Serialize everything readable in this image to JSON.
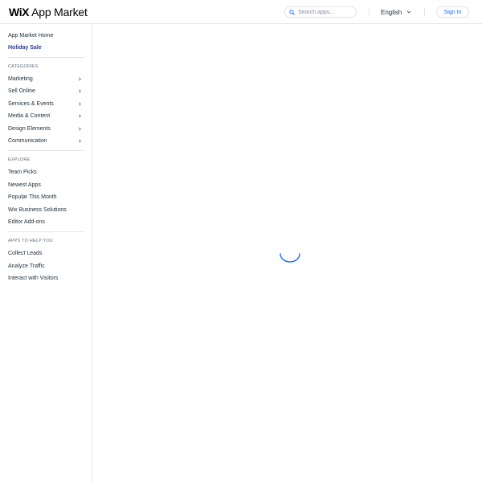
{
  "header": {
    "logo": {
      "brand": "WiX",
      "product": "App Market"
    },
    "search": {
      "placeholder": "Search apps..."
    },
    "language": "English",
    "sign_in": "Sign In"
  },
  "sidebar": {
    "top": [
      {
        "label": "App Market Home",
        "active": false
      },
      {
        "label": "Holiday Sale",
        "active": true
      }
    ],
    "categories": {
      "title": "CATEGORIES",
      "items": [
        {
          "label": "Marketing"
        },
        {
          "label": "Sell Online"
        },
        {
          "label": "Services & Events"
        },
        {
          "label": "Media & Content"
        },
        {
          "label": "Design Elements"
        },
        {
          "label": "Communication"
        }
      ]
    },
    "explore": {
      "title": "EXPLORE",
      "items": [
        {
          "label": "Team Picks"
        },
        {
          "label": "Newest Apps"
        },
        {
          "label": "Popular This Month"
        },
        {
          "label": "Wix Business Solutions"
        },
        {
          "label": "Editor Add-ons"
        }
      ]
    },
    "help": {
      "title": "APPS TO HELP YOU",
      "items": [
        {
          "label": "Collect Leads"
        },
        {
          "label": "Analyze Traffic"
        },
        {
          "label": "Interact with Visitors"
        }
      ]
    }
  },
  "colors": {
    "accent": "#116dff",
    "active_nav": "#2b3a9a",
    "spinner": "#116dff",
    "border": "#dfe5eb"
  },
  "icons": {
    "search": "search-icon",
    "language_dropdown": "chevron-down-icon",
    "category_arrow": "chevron-right-icon",
    "loading": "loading-spinner-icon"
  }
}
